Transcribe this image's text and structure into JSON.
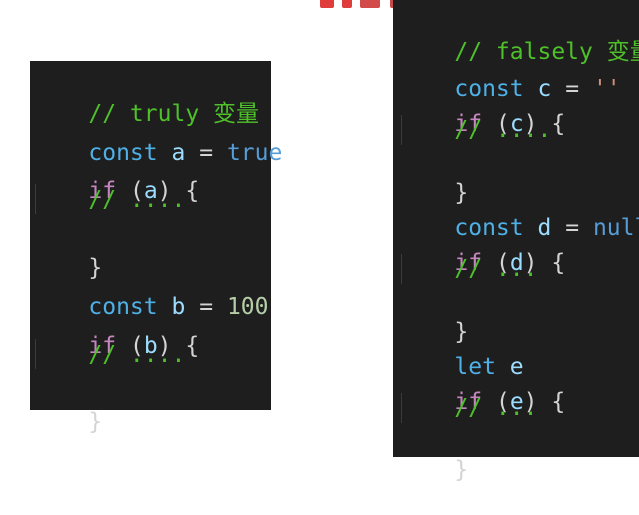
{
  "colors": {
    "background": "#ffffff",
    "editor_bg": "#1e1e1e",
    "comment": "#4ec02a",
    "keyword": "#4fb0e6",
    "control": "#c586c0",
    "variable": "#9cdcfe",
    "boolean": "#569cd6",
    "number": "#b5cea8",
    "string": "#ce9178",
    "punctuation": "#d4d4d4",
    "top_mark_red": "#e03c3c"
  },
  "left_panel": {
    "lines": {
      "l1": {
        "comment": "// truly 变量"
      },
      "l2": {
        "kw": "const",
        "name": "a",
        "eq": "=",
        "val": "true"
      },
      "l3": {
        "kw": "if",
        "open": "(",
        "name": "a",
        "close": ")",
        "brace": "{"
      },
      "l4": {
        "comment": "// ...."
      },
      "l5": {
        "brace": "}"
      },
      "l6": {
        "kw": "const",
        "name": "b",
        "eq": "=",
        "val": "100"
      },
      "l7": {
        "kw": "if",
        "open": "(",
        "name": "b",
        "close": ")",
        "brace": "{"
      },
      "l8": {
        "comment": "// ...."
      },
      "l9": {
        "brace": "}"
      }
    }
  },
  "right_panel": {
    "lines": {
      "l1": {
        "comment": "// falsely 变量"
      },
      "l2": {
        "kw": "const",
        "name": "c",
        "eq": "=",
        "val": "''"
      },
      "l3": {
        "kw": "if",
        "open": "(",
        "name": "c",
        "close": ")",
        "brace": "{"
      },
      "l4": {
        "comment": "// ...."
      },
      "l5": {
        "brace": "}"
      },
      "l6": {
        "kw": "const",
        "name": "d",
        "eq": "=",
        "val": "null"
      },
      "l7": {
        "kw": "if",
        "open": "(",
        "name": "d",
        "close": ")",
        "brace": "{"
      },
      "l8": {
        "comment": "// ..."
      },
      "l9": {
        "brace": "}"
      },
      "l10": {
        "kw": "let",
        "name": "e"
      },
      "l11": {
        "kw": "if",
        "open": "(",
        "name": "e",
        "close": ")",
        "brace": "{"
      },
      "l12": {
        "comment": "// ..."
      },
      "l13": {
        "brace": "}"
      }
    }
  }
}
